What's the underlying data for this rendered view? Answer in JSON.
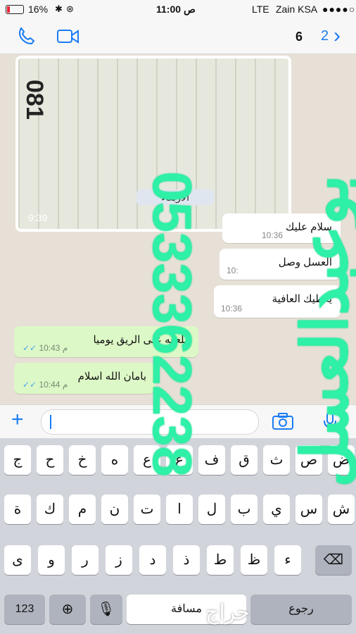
{
  "status": {
    "battery": "16%",
    "time": "11:00 ص",
    "network": "LTE",
    "carrier": "Zain KSA"
  },
  "nav": {
    "back_count": "2",
    "contact_suffix": "6"
  },
  "chat": {
    "photo_time": "9:39",
    "photo_number": "081",
    "day_label": "الأربعاء",
    "incoming": [
      {
        "text": "سلام عليك",
        "time": "10:36"
      },
      {
        "text": "العسل وصل",
        "time": "10:"
      },
      {
        "text": "يعطيك العافية",
        "time": "10:36"
      }
    ],
    "outgoing": [
      {
        "text": "ملعقه على الريق يوميا",
        "time": "10:43 م"
      },
      {
        "text": "بامان الله اسلام",
        "time": "10:44 م"
      }
    ]
  },
  "keyboard": {
    "row1": [
      "ض",
      "ص",
      "ث",
      "ق",
      "ف",
      "غ",
      "ع",
      "ه",
      "خ",
      "ح",
      "ج"
    ],
    "row2": [
      "ش",
      "س",
      "ي",
      "ب",
      "ل",
      "ا",
      "ت",
      "ن",
      "م",
      "ك",
      "ة"
    ],
    "row3": [
      "ء",
      "ظ",
      "ط",
      "ذ",
      "د",
      "ز",
      "ر",
      "و",
      "ى"
    ],
    "numbers": "123",
    "space": "مسافة",
    "return": "رجوع"
  },
  "watermark": {
    "phone": "0533362238",
    "text": "بوعبدالعسل"
  },
  "logo": "حراج"
}
